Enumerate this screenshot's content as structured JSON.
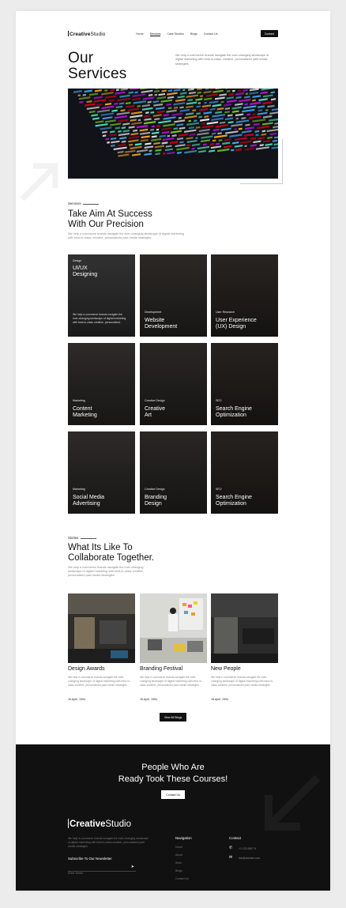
{
  "header": {
    "logo_bold": "Creative",
    "logo_rest": "Studio",
    "menu": [
      "Home",
      "Services",
      "Case Studies",
      "Blogs",
      "Contact Us"
    ],
    "active_menu": "Services",
    "contact_button": "Contact"
  },
  "hero": {
    "title_line1": "Our",
    "title_line2": "Services",
    "text": "We help e-commerce brands navigate the ever-changing landscape of digital marketing with best-in-class, creative, personalized paid media strategies."
  },
  "services": {
    "label": "Services",
    "title_line1": "Take Aim At Success",
    "title_line2": "With Our Precision",
    "text": "We help e-commerce brands navigate the ever-changing landscape of digital marketing with best-in-class, creative, personalized paid media strategies.",
    "cards": [
      {
        "category": "Design",
        "name_line1": "UI/UX",
        "name_line2": "Designing",
        "desc": "We help e-commerce brands navigate the ever-changing landscape of digital marketing with best-in-class creative, personalized."
      },
      {
        "category": "Development",
        "name_line1": "Website",
        "name_line2": "Development"
      },
      {
        "category": "User Research",
        "name_line1": "User Experience",
        "name_line2": "(UX) Design"
      },
      {
        "category": "Marketing",
        "name_line1": "Content",
        "name_line2": "Marketing"
      },
      {
        "category": "Creative Design",
        "name_line1": "Creative",
        "name_line2": "Art"
      },
      {
        "category": "SEO",
        "name_line1": "Search Engine",
        "name_line2": "Optimization"
      },
      {
        "category": "Marketing",
        "name_line1": "Social Media",
        "name_line2": "Advertising"
      },
      {
        "category": "Creative Design",
        "name_line1": "Branding",
        "name_line2": "Design"
      },
      {
        "category": "SEO",
        "name_line1": "Search Engine",
        "name_line2": "Optimization"
      }
    ]
  },
  "stories": {
    "label": "Stories",
    "title_line1": "What Its Like To",
    "title_line2": "Collaborate Together.",
    "text": "We help e-commerce brands navigate the ever-changing landscape of digital marketing with best-in-class creative, personalized paid media strategies.",
    "items": [
      {
        "title": "Design Awards",
        "text": "We help e-commerce brands navigate the ever-changing landscape of digital marketing with best-in-class creative, personalized paid media strategies.",
        "date": "16 April, 1994"
      },
      {
        "title": "Branding Festival",
        "text": "We help e-commerce brands navigate the ever-changing landscape of digital marketing with best-in-class creative, personalized paid media strategies.",
        "date": "16 April, 1994"
      },
      {
        "title": "New People",
        "text": "We help e-commerce brands navigate the ever-changing landscape of digital marketing with best-in-class creative, personalized paid media strategies.",
        "date": "16 April, 1994"
      }
    ],
    "view_all": "View All Blogs"
  },
  "footer": {
    "cta_line1": "People Who Are",
    "cta_line2": "Ready Took These Courses!",
    "cta_button": "Contact Us",
    "logo_bold": "Creative",
    "logo_rest": "Studio",
    "text": "We help e-commerce brands navigate the ever-changing landscape of digital marketing with best-in-class creative, personalized paid media strategies.",
    "newsletter_title": "Subscribe To Our Newsletter",
    "newsletter_placeholder": "Enter Email",
    "nav_title": "Navigation",
    "nav_links": [
      "Home",
      "About",
      "Work",
      "Blogs",
      "Contact Us"
    ],
    "contact_title": "Contact",
    "phone": "+1 123 4567 9",
    "email": "info@domain.com"
  },
  "colors": {
    "accent": "#111111",
    "background": "#ffffff",
    "footer": "#111111"
  }
}
